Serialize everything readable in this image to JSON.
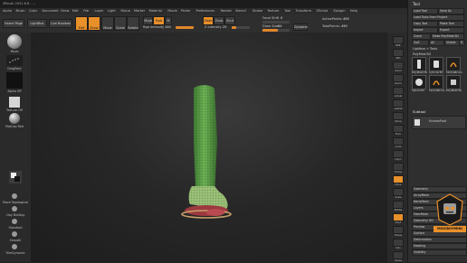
{
  "title_bar": {
    "text": "ZBrush 2021.6.6 - ..."
  },
  "menu": {
    "items": [
      "Alpha",
      "Brush",
      "Color",
      "Document",
      "Draw",
      "Edit",
      "File",
      "Layer",
      "Light",
      "Macro",
      "Marker",
      "Material",
      "Movie",
      "Picker",
      "Preferences",
      "Render",
      "Stencil",
      "Stroke",
      "Texture",
      "Tool",
      "Transform",
      "ZScript",
      "Zplugin",
      "Help"
    ]
  },
  "toolbar": {
    "home_page": "Home Page",
    "lightbox": "LightBox",
    "live_boolean": "Live Boolean",
    "edit": "Edit",
    "draw": "Draw",
    "move": "Move",
    "scale": "Scale",
    "rotate": "Rotate",
    "mrgb": "Mrgb",
    "rgb": "Rgb",
    "m": "M",
    "zadd": "Zadd",
    "zsub": "Zsub",
    "zcut": "Zcut",
    "rgb_intensity_label": "Rgb Intensity",
    "rgb_intensity_value": "100",
    "rgb_intensity_fraction": 1.0,
    "z_intensity_label": "Z Intensity",
    "z_intensity_value": "25",
    "z_intensity_fraction": 0.25,
    "focal_shift_label": "Focal Shift",
    "focal_shift_value": "0",
    "draw_size_label": "Draw Size",
    "draw_size_value": "64",
    "draw_size_fraction": 0.55,
    "dynamic": "Dynamic",
    "active_points_label": "ActivePoints:",
    "active_points_value": "490",
    "total_points_label": "TotalPoints:",
    "total_points_value": "490"
  },
  "left_shelf": {
    "brush_label": "Move",
    "stroke_label": "DragRect",
    "alpha_label": "Alpha Off",
    "texture_label": "Texture Off",
    "material_label": "MatCap Red",
    "gradient_label": "Gradient",
    "switch_color_label": "SwitchColor",
    "alternate_label": "Alternate",
    "bottom_brushes": [
      "Move Topological",
      "Clay Buildup",
      "Standard",
      "Smooth",
      "TrimDynamic"
    ]
  },
  "right_shelf": {
    "buttons": [
      "BPR",
      "SPix",
      "Scroll",
      "Zoom",
      "Actual",
      "AAHalf",
      "Persp",
      "Floor",
      "Local",
      "LSym",
      "Frame",
      "Move",
      "Scale",
      "Rotate",
      "PolyF",
      "Transp",
      "Solo",
      "Xpose"
    ]
  },
  "tray": {
    "header": "Tool",
    "rows": [
      "Load Tool",
      "Save As",
      "Load Tools From Project",
      "Copy Tool",
      "Paste Tool",
      "Import",
      "Export",
      "Clone",
      "Make PolyMesh3D",
      "GoZ",
      "All",
      "Visible",
      "R"
    ],
    "lightbox_tools": "Lightbox > Tools",
    "current_tool_label": "PolyMesh3D",
    "thumbnails": [
      "PolyMesh3D",
      "Cylinder3D",
      "SimpleBrush",
      "Sphere3D",
      "SimpleBrush",
      "PolyMesh3D",
      "PolyMesh3D",
      "PolyMesh3D",
      "PolyMesh3D"
    ],
    "subtool": "Subtool",
    "subtool_item": "HumanFoot",
    "bottom_rows": [
      "Geometry",
      "ArrayMesh",
      "NanoMesh",
      "Layers",
      "FiberMesh",
      "Geometry HD",
      "Preview",
      "Surface",
      "Deformation",
      "Masking",
      "Visibility",
      "Polygroups",
      "Contact",
      "Morph Target",
      "Polypaint",
      "UV Map",
      "Texture Map",
      "Displacement Map",
      "Normal Map",
      "Vector Displacement Map",
      "Display Properties",
      "Unified Skin",
      "Initialize",
      "Import",
      "Export"
    ],
    "badge": "MISCBOYMINI"
  },
  "colors": {
    "accent": "#e8902a",
    "model_green": "#5fa24a",
    "model_red": "#9c3a3f",
    "background": "#232323"
  }
}
